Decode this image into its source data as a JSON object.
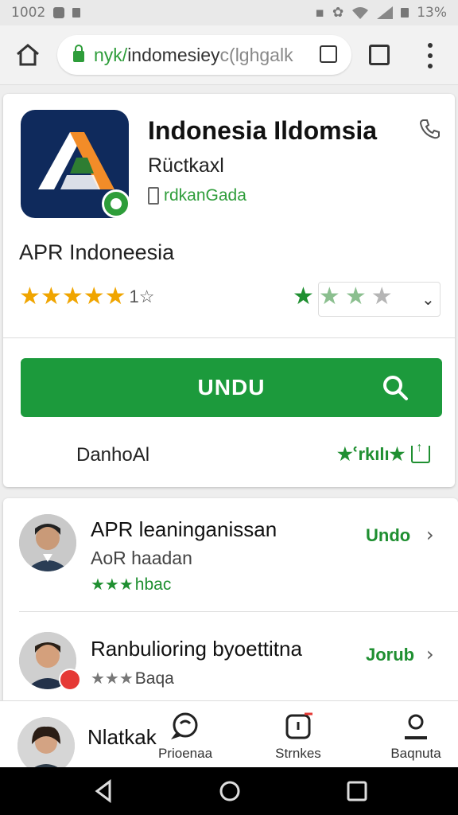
{
  "status_bar": {
    "time": "1002",
    "battery": "13%"
  },
  "browser": {
    "url_prefix": "nyk/",
    "url_domain": "indomesiey",
    "url_suffix": "c(lghgalk"
  },
  "app": {
    "title": "Indonesia Ildomsia",
    "publisher": "Rüctkaxl",
    "device_compat": "rdkanGada",
    "name": "APR Indoneesia",
    "rating_text": "1☆",
    "install_label": "UNDU",
    "download_label": "DanhoAl",
    "share_stars": "★ՙrkılı★"
  },
  "related": [
    {
      "title": "APR leaninganissan",
      "subtitle": "AoR haadan",
      "stars": "★★★",
      "stars_text": "hbac",
      "action": "Undo"
    },
    {
      "title": "Ranbulioring byoettitna",
      "subtitle": "",
      "stars": "★★★",
      "stars_text": "Baqa",
      "action": "Jorub"
    }
  ],
  "bottom_nav": {
    "peek_text": "Nlatkak",
    "items": [
      {
        "label": "Prioenaa",
        "icon": "chat-icon"
      },
      {
        "label": "Strnkes",
        "icon": "timer-icon"
      },
      {
        "label": "Baqnuta",
        "icon": "person-icon"
      }
    ]
  },
  "colors": {
    "accent": "#1c9a3c",
    "star_orange": "#f0a500",
    "icon_bg": "#0f2a5c"
  }
}
